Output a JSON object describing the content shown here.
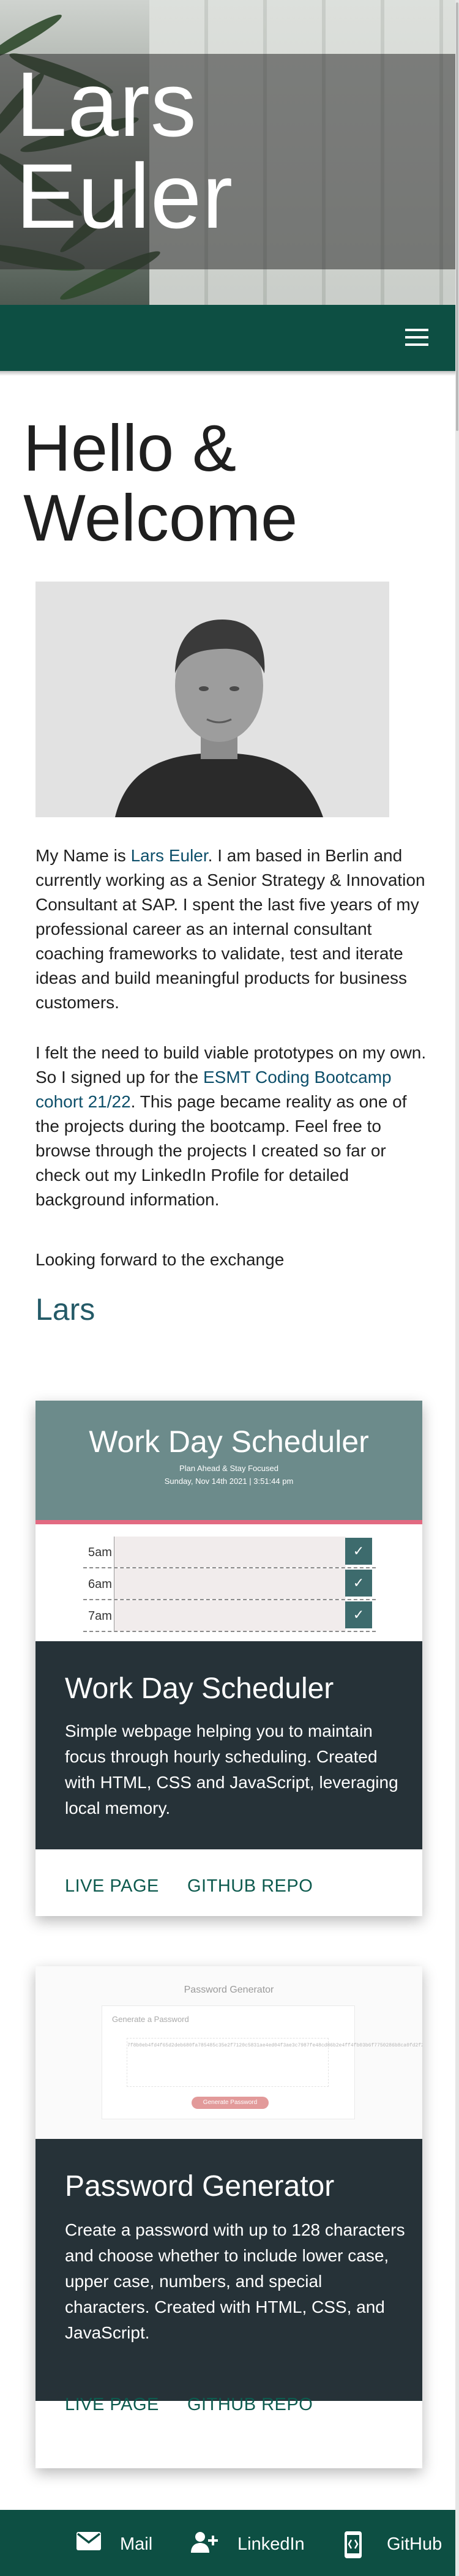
{
  "site": {
    "owner_name": "Lars Euler"
  },
  "hero": {
    "title_line1": "Lars",
    "title_line2": "Euler"
  },
  "nav": {
    "menu_icon": "hamburger-menu-icon"
  },
  "intro": {
    "heading_line1": "Hello &",
    "heading_line2": "Welcome",
    "portrait_alt": "Portrait photo",
    "para1_before": "My Name is ",
    "para1_link": "Lars Euler",
    "para1_after": ". I am based in Berlin and currently working as a Senior Strategy & Innovation Consultant at SAP. I spent the last five years of my professional career as an internal consultant coaching frameworks to validate, test and iterate ideas and build meaningful products for business customers.",
    "para2_before": "I felt the need to build viable prototypes on my own. So I signed up for the ",
    "para2_link": "ESMT Coding Bootcamp cohort 21/22",
    "para2_after": ". This page became reality as one of the projects during the bootcamp. Feel free to browse through the projects I created so far or check out my LinkedIn Profile for detailed background information.",
    "para3": "Looking forward to the exchange",
    "signoff": "Lars"
  },
  "projects": [
    {
      "title": "Work Day Scheduler",
      "description": "Simple webpage helping you to maintain focus through hourly scheduling. Created with HTML, CSS and JavaScript, leveraging local memory.",
      "live_label": "LIVE PAGE",
      "repo_label": "GITHUB REPO",
      "preview": {
        "title": "Work Day Scheduler",
        "subtitle": "Plan Ahead & Stay Focused",
        "date": "Sunday, Nov 14th 2021 | 3:51:44 pm",
        "hours": [
          "5am",
          "6am",
          "7am"
        ],
        "check": "✓"
      }
    },
    {
      "title": "Password Generator",
      "description": "Create a password with up to 128 characters and choose whether to include lower case, upper case, numbers, and special characters. Created with HTML, CSS, and JavaScript.",
      "live_label": "LIVE PAGE",
      "repo_label": "GITHUB REPO",
      "preview": {
        "title": "Password Generator",
        "box_title": "Generate a Password",
        "password": "7f8b0eb4fd4f65d2deb680fa785485c35e2f7120c5831ae4ed04f3ae3c7987fe48cd86b2e4ff4fb03b6f7750286b8ca0fd2f29ac9b56f465256eff1cd6f09",
        "button": "Generate Password"
      }
    }
  ],
  "footer": {
    "mail_label": "Mail",
    "linkedin_label": "LinkedIn",
    "github_label": "GitHub"
  },
  "colors": {
    "primary": "#0d4f43",
    "card_dark": "#263238",
    "accent_link": "#245a67",
    "scheduler_header": "#6c8b8b",
    "scheduler_stripe": "#e26a81"
  }
}
